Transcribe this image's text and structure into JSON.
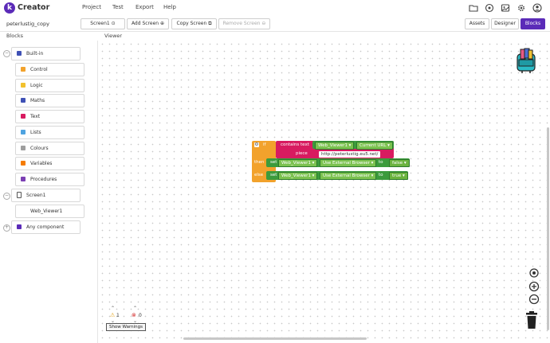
{
  "app": {
    "brand": "Creator",
    "logo_letter": "k"
  },
  "menu": [
    "Project",
    "Test",
    "Export",
    "Help"
  ],
  "toolbar": {
    "project_name": "peterlustig_copy",
    "screen_select": "Screen1",
    "add_screen": "Add Screen",
    "copy_screen": "Copy Screen",
    "remove_screen": "Remove Screen",
    "views": [
      "Assets",
      "Designer",
      "Blocks"
    ],
    "active_view": "Blocks"
  },
  "panels": {
    "blocks_title": "Blocks",
    "viewer_title": "Viewer"
  },
  "builtin": {
    "label": "Built-in",
    "items": [
      {
        "label": "Control",
        "color": "#f2a22c"
      },
      {
        "label": "Logic",
        "color": "#f2c12e"
      },
      {
        "label": "Maths",
        "color": "#3f51b5"
      },
      {
        "label": "Text",
        "color": "#d81b60"
      },
      {
        "label": "Lists",
        "color": "#4fa3e0"
      },
      {
        "label": "Colours",
        "color": "#9e9e9e"
      },
      {
        "label": "Variables",
        "color": "#f57c00"
      },
      {
        "label": "Procedures",
        "color": "#7b3fb3"
      }
    ]
  },
  "components": {
    "screen": "Screen1",
    "child": "Web_Viewer1",
    "any": "Any component"
  },
  "code_block": {
    "if_kw": "if",
    "contains_text": "contains text",
    "component": "Web_Viewer1",
    "property": "Current URL",
    "piece": "piece",
    "url": "http://peterlustig.eu5.net/",
    "then_kw": "then",
    "else_kw": "else",
    "set_kw": "set",
    "set_property": "Use External Browser",
    "to_kw": "to",
    "then_value": "false",
    "else_value": "true"
  },
  "warnings": {
    "warn_count": "1",
    "error_count": "0",
    "show_label": "Show Warnings"
  },
  "colors": {
    "accent": "#5b2bb8",
    "control": "#f2a22c",
    "text": "#d81b60",
    "component": "#3c9b3c",
    "component_light": "#7cc250"
  }
}
